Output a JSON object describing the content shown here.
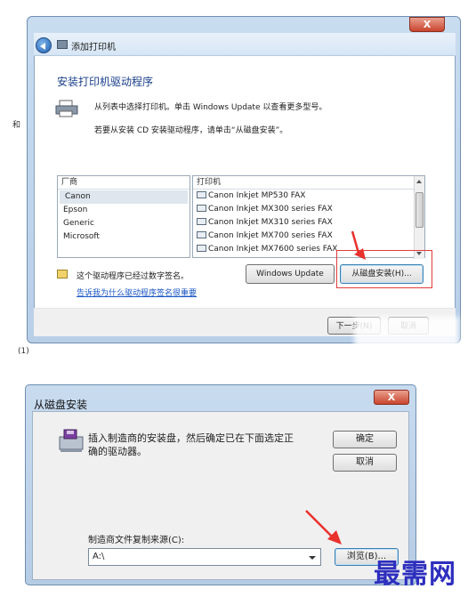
{
  "window1": {
    "title": "添加打印机",
    "close": "X",
    "heading": "安装打印机驱动程序",
    "instruction1": "从列表中选择打印机。单击 Windows Update 以查看更多型号。",
    "instruction2": "若要从安装 CD 安装驱动程序，请单击“从磁盘安装”。",
    "manufacturer_header": "厂商",
    "manufacturers": [
      "Canon",
      "Epson",
      "Generic",
      "Microsoft"
    ],
    "selected_manufacturer": "Canon",
    "printers_header": "打印机",
    "printers": [
      "Canon Inkjet MP530 FAX",
      "Canon Inkjet MX300 series FAX",
      "Canon Inkjet MX310 series FAX",
      "Canon Inkjet MX700 series FAX",
      "Canon Inkjet MX7600 series FAX"
    ],
    "signed_text": "这个驱动程序已经过数字签名。",
    "signing_link": "告诉我为什么驱动程序签名很重要",
    "windows_update_button": "Windows Update",
    "have_disk_button": "从磁盘安装(H)...",
    "next_button": "下一步(N)",
    "cancel_button": "取消"
  },
  "background_fragments": {
    "left_texts": [
      "和",
      "(1)"
    ]
  },
  "window2": {
    "title": "从磁盘安装",
    "close": "X",
    "message_line1": "插入制造商的安装盘，然后确定已在下面选定正",
    "message_line2": "确的驱动器。",
    "ok_button": "确定",
    "cancel_button": "取消",
    "source_label": "制造商文件复制来源(C):",
    "source_value": "A:\\",
    "browse_button": "浏览(B)..."
  },
  "watermark": "最需网",
  "colors": {
    "accent": "#1a3f8a",
    "link": "#1a56c4",
    "highlight_box": "#e23b3b",
    "arrow": "#e8302d"
  }
}
